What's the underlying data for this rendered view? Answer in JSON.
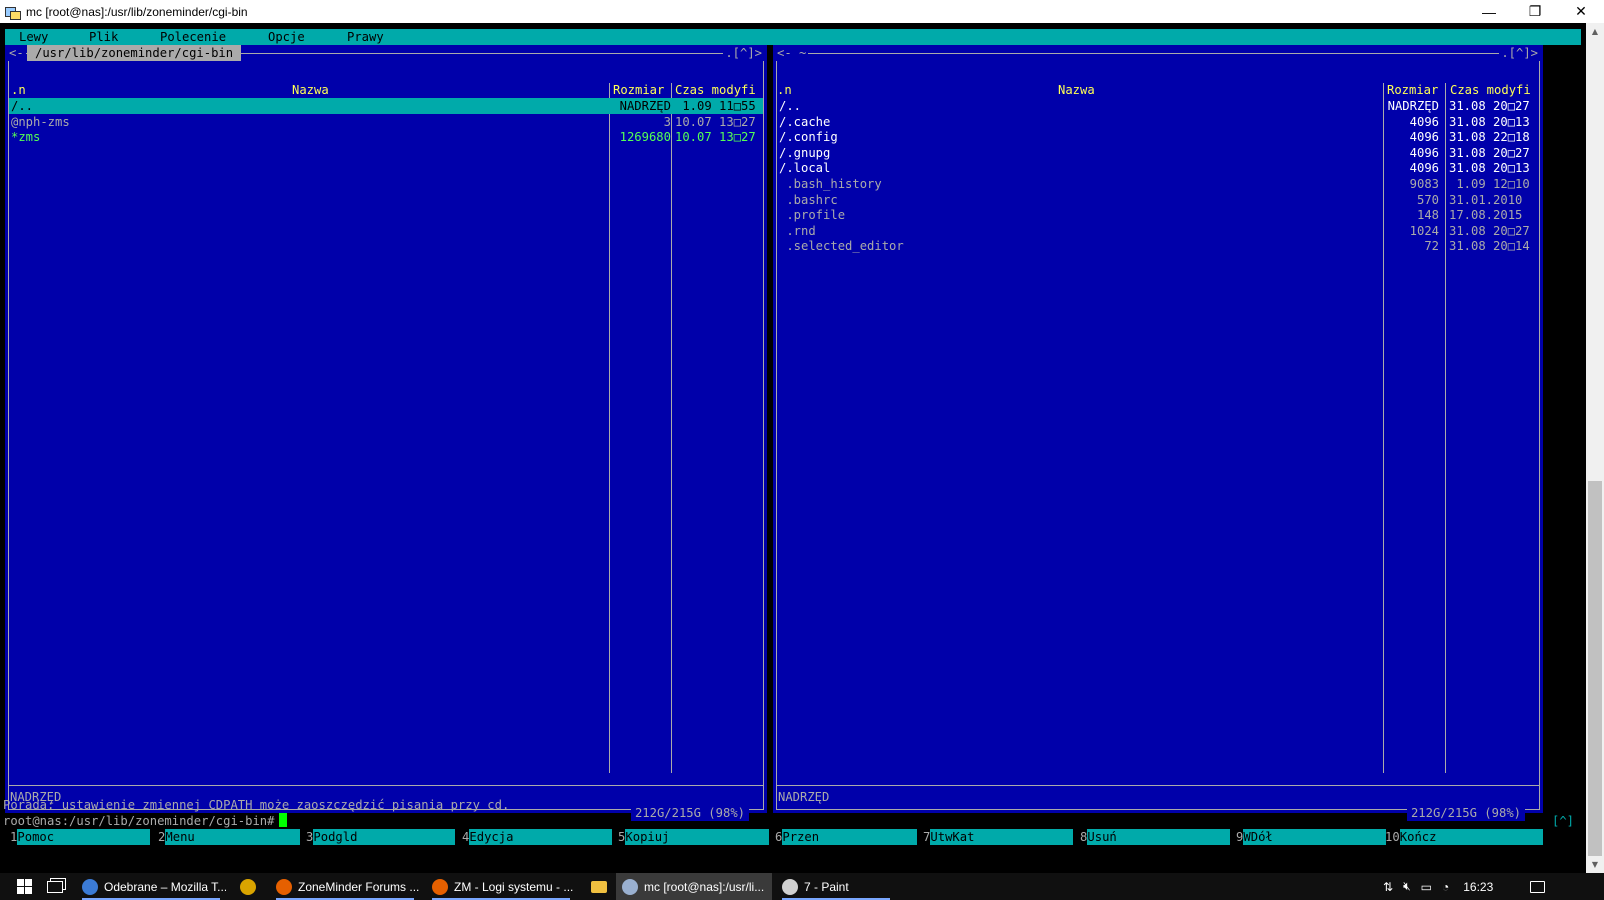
{
  "window": {
    "title": "mc [root@nas]:/usr/lib/zoneminder/cgi-bin",
    "minimize": "—",
    "restore": "❐",
    "close": "✕"
  },
  "menubar": [
    "Lewy",
    "Plik",
    "Polecenie",
    "Opcje",
    "Prawy"
  ],
  "left_panel": {
    "corner_left": "<-",
    "corner_right": ".[^]>",
    "path": "/usr/lib/zoneminder/cgi-bin",
    "sort_col": ".n",
    "headers": {
      "name": "Nazwa",
      "size": "Rozmiar",
      "time": "Czas modyfi"
    },
    "rows": [
      {
        "name": "/..",
        "size": "NADRZĘD",
        "time": " 1.09 11□55",
        "kind": "sel"
      },
      {
        "name": "@nph-zms",
        "size": "3",
        "time": "10.07 13□27",
        "kind": "link"
      },
      {
        "name": "*zms",
        "size": "1269680",
        "time": "10.07 13□27",
        "kind": "exe"
      }
    ],
    "status": "NADRZĘD",
    "disk": "212G/215G (98%)"
  },
  "right_panel": {
    "corner_left": "<- ~",
    "corner_right": ".[^]>",
    "sort_col": ".n",
    "headers": {
      "name": "Nazwa",
      "size": "Rozmiar",
      "time": "Czas modyfi"
    },
    "rows": [
      {
        "name": "/..",
        "size": "NADRZĘD",
        "time": "31.08 20□27",
        "kind": "dir"
      },
      {
        "name": "/.cache",
        "size": "4096",
        "time": "31.08 20□13",
        "kind": "dir"
      },
      {
        "name": "/.config",
        "size": "4096",
        "time": "31.08 22□18",
        "kind": "dir"
      },
      {
        "name": "/.gnupg",
        "size": "4096",
        "time": "31.08 20□27",
        "kind": "dir"
      },
      {
        "name": "/.local",
        "size": "4096",
        "time": "31.08 20□13",
        "kind": "dir"
      },
      {
        "name": " .bash_history",
        "size": "9083",
        "time": " 1.09 12□10",
        "kind": "hidden"
      },
      {
        "name": " .bashrc",
        "size": "570",
        "time": "31.01.2010",
        "kind": "hidden"
      },
      {
        "name": " .profile",
        "size": "148",
        "time": "17.08.2015",
        "kind": "hidden"
      },
      {
        "name": " .rnd",
        "size": "1024",
        "time": "31.08 20□27",
        "kind": "hidden"
      },
      {
        "name": " .selected_editor",
        "size": "72",
        "time": "31.08 20□14",
        "kind": "hidden"
      }
    ],
    "status": "NADRZĘD",
    "disk": "212G/215G (98%)"
  },
  "hint": "Porada: ustawienie zmiennej CDPATH może zaoszczędzić pisania przy cd.",
  "prompt": "root@nas:/usr/lib/zoneminder/cgi-bin#",
  "prompt_bracket": "[^]",
  "fkeys": [
    {
      "num": "1",
      "label": "Pomoc"
    },
    {
      "num": "2",
      "label": "Menu"
    },
    {
      "num": "3",
      "label": "Podgld"
    },
    {
      "num": "4",
      "label": "Edycja"
    },
    {
      "num": "5",
      "label": "Kopiuj"
    },
    {
      "num": "6",
      "label": "Przen"
    },
    {
      "num": "7",
      "label": "UtwKat"
    },
    {
      "num": "8",
      "label": "Usuń"
    },
    {
      "num": "9",
      "label": "WDół"
    },
    {
      "num": "10",
      "label": "Kończ"
    }
  ],
  "taskbar": {
    "items": [
      {
        "label": "Odebrane – Mozilla T...",
        "icon": "thunderbird-icon",
        "color": "#3b7bd6",
        "state": "open"
      },
      {
        "label": "",
        "icon": "putty-icon",
        "color": "#d9a400",
        "state": "none"
      },
      {
        "label": "ZoneMinder Forums ...",
        "icon": "firefox-icon",
        "color": "#e66000",
        "state": "open"
      },
      {
        "label": "ZM - Logi systemu - ...",
        "icon": "firefox-icon",
        "color": "#e66000",
        "state": "open"
      },
      {
        "label": "",
        "icon": "folder-icon",
        "color": "#f0c040",
        "state": "none"
      },
      {
        "label": "mc [root@nas]:/usr/li...",
        "icon": "putty-icon",
        "color": "#9ab0d0",
        "state": "active"
      },
      {
        "label": "7 - Paint",
        "icon": "paint-icon",
        "color": "#d0d0d0",
        "state": "open"
      }
    ],
    "clock": "16:23"
  }
}
